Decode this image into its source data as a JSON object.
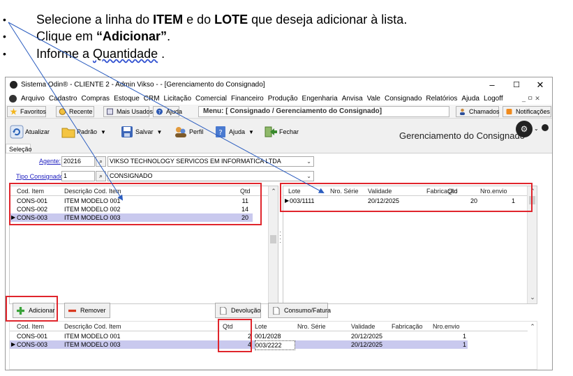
{
  "instructions": [
    {
      "pre": "Selecione a linha do ",
      "b1": "ITEM",
      "mid": " e do ",
      "b2": "LOTE",
      "post": " que deseja adicionar à lista."
    },
    {
      "pre": "Clique em ",
      "b1": "“Adicionar”",
      "post": "."
    },
    {
      "pre": "Informe a ",
      "u": "Quantidade",
      "post": " ."
    }
  ],
  "bullet_char": "•",
  "window": {
    "title": "Sistema Odin® - CLIENTE 2 - Admin Vikso - - [Gerenciamento do Consignado]",
    "min": "–",
    "max": "☐",
    "close": "✕"
  },
  "menu": [
    "Arquivo",
    "Cadastro",
    "Compras",
    "Estoque",
    "CRM",
    "Licitação",
    "Comercial",
    "Financeiro",
    "Produção",
    "Engenharia",
    "Anvisa",
    "Vale",
    "Consignado",
    "Relatórios",
    "Ajuda",
    "Logoff"
  ],
  "mdi_controls": "_ ㅁ ✕",
  "favbar": {
    "favoritos": "Favoritos",
    "recente": "Recente",
    "mais_usados": "Mais Usados",
    "ajuda": "Ajuda",
    "menu_path": "Menu: [ Consignado / Gerenciamento do Consignado]",
    "chamados": "Chamados",
    "notificacoes": "Notificações"
  },
  "toolbar": {
    "atualizar": "Atualizar",
    "padrao": "Padrão",
    "salvar": "Salvar",
    "perfil": "Perfil",
    "ajuda": "Ajuda",
    "fechar": "Fechar",
    "screen_title": "Gerenciamento do Consignado"
  },
  "tab": "Seleção",
  "form": {
    "agente_label": "Agente:",
    "agente_code": "20216",
    "agente_name": "VIKSO TECHNOLOGY SERVICOS EM INFORMATICA LTDA",
    "tipo_label": "Tipo Consignado:",
    "tipo_code": "1",
    "tipo_name": "CONSIGNADO"
  },
  "items_grid": {
    "headers": [
      "Cod. Item",
      "Descrição Cod. Item",
      "Qtd"
    ],
    "rows": [
      [
        "CONS-001",
        "ITEM MODELO 001",
        "11"
      ],
      [
        "CONS-002",
        "ITEM MODELO 002",
        "14"
      ],
      [
        "CONS-003",
        "ITEM MODELO 003",
        "20"
      ]
    ]
  },
  "lots_grid": {
    "headers": [
      "Lote",
      "Nro. Série",
      "Validade",
      "Fabricação",
      "Qtd",
      "Nro.envio"
    ],
    "rows": [
      [
        "003/1111",
        "",
        "20/12/2025",
        "",
        "20",
        "1"
      ]
    ]
  },
  "actions": {
    "adicionar": "Adicionar",
    "remover": "Remover",
    "devolucao": "Devolução",
    "consumo": "Consumo/Fatura"
  },
  "list_grid": {
    "headers": [
      "Cod. Item",
      "Descrição Cod. Item",
      "Qtd",
      "Lote",
      "Nro. Série",
      "Validade",
      "Fabricação",
      "Nro.envio"
    ],
    "rows": [
      [
        "CONS-001",
        "ITEM MODELO 001",
        "2",
        "001/2028",
        "",
        "20/12/2025",
        "",
        "1"
      ],
      [
        "CONS-003",
        "ITEM MODELO 003",
        "4",
        "003/2222",
        "",
        "20/12/2025",
        "",
        "1"
      ]
    ]
  },
  "colors": {
    "highlight": "#e0252c",
    "selected_row": "#c9c9ee",
    "arrow": "#2a5cbf"
  }
}
